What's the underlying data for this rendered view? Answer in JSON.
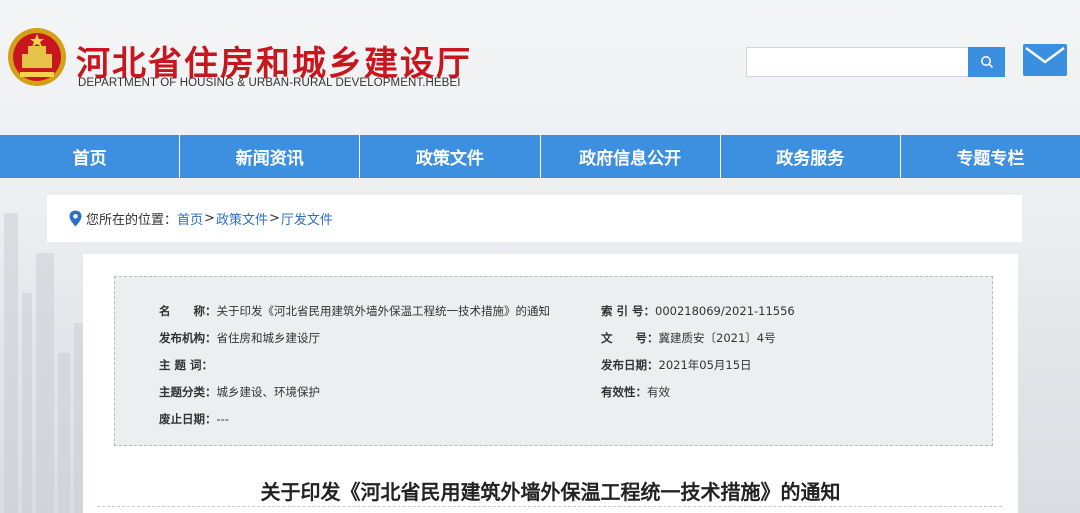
{
  "header": {
    "title": "河北省住房和城乡建设厅",
    "subtitle": "DEPARTMENT OF HOUSING & URBAN-RURAL DEVELOPMENT.HEBEI",
    "search_value": "",
    "icons": {
      "search": "search-icon",
      "mail": "mail-icon",
      "emblem": "national-emblem"
    }
  },
  "colors": {
    "brand_red": "#c8161e",
    "nav_blue": "#3d8fe0",
    "link_blue": "#2c6fc6"
  },
  "nav": [
    {
      "label": "首页"
    },
    {
      "label": "新闻资讯"
    },
    {
      "label": "政策文件"
    },
    {
      "label": "政府信息公开"
    },
    {
      "label": "政务服务"
    },
    {
      "label": "专题专栏"
    }
  ],
  "breadcrumb": {
    "prefix": "您所在的位置：",
    "items": [
      "首页",
      "政策文件",
      "厅发文件"
    ],
    "separator": ">"
  },
  "meta": {
    "name_label": "名　　称：",
    "name_value": "关于印发《河北省民用建筑外墙外保温工程统一技术措施》的通知",
    "index_label": "索 引 号：",
    "index_value": "000218069/2021-11556",
    "org_label": "发布机构：",
    "org_value": "省住房和城乡建设厅",
    "docno_label": "文　　号：",
    "docno_value": "冀建质安〔2021〕4号",
    "keywords_label": "主 题 词：",
    "keywords_value": "",
    "date_label": "发布日期：",
    "date_value": "2021年05月15日",
    "category_label": "主题分类：",
    "category_value": "城乡建设、环境保护",
    "validity_label": "有效性：",
    "validity_value": "有效",
    "expiry_label": "废止日期：",
    "expiry_value": "---"
  },
  "document": {
    "title": "关于印发《河北省民用建筑外墙外保温工程统一技术措施》的通知"
  }
}
